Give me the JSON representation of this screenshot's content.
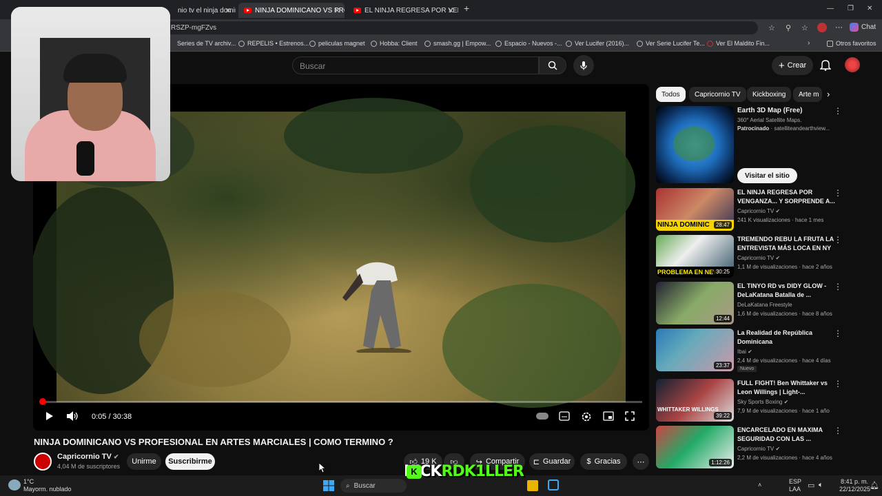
{
  "browser": {
    "tabs": [
      {
        "label": "nio tv el ninja dominicano"
      },
      {
        "label": "NINJA DOMINICANO VS PROFESIO"
      },
      {
        "label": "EL NINJA REGRESA POR VENGANZ"
      }
    ],
    "url": "RSZP-mgFZvs",
    "bookmarks": [
      "Series de TV archiv...",
      "REPELIS • Estrenos...",
      "peliculas magnet",
      "Hobba: Client",
      "smash.gg | Empow...",
      "Espacio - Nuevos -...",
      "Ver Lucifer (2016)...",
      "Ver Serie Lucifer Te...",
      "Ver El Maldito Fin...",
      "Otros favoritos"
    ],
    "chat_label": "Chat"
  },
  "youtube": {
    "search_placeholder": "Buscar",
    "create_label": "Crear"
  },
  "player": {
    "time": "0:05 / 30:38",
    "progress_fraction": 0.003
  },
  "video": {
    "title": "NINJA DOMINICANO VS PROFESIONAL EN ARTES MARCIALES | COMO TERMINO ?",
    "channel": "Capricornio TV",
    "subscribers": "4,04 M de suscriptores",
    "join_label": "Unirme",
    "subscribe_label": "Suscribirme",
    "likes": "19 K",
    "share_label": "Compartir",
    "save_label": "Guardar",
    "thanks_label": "Gracias"
  },
  "chips": [
    "Todos",
    "Capricornio TV",
    "Kickboxing",
    "Arte m"
  ],
  "ad": {
    "title": "Earth 3D Map (Free)",
    "subtitle": "360° Aerial Satellite Maps.",
    "sponsored": "Patrocinado",
    "domain": "satelliteandearthview...",
    "cta": "Visitar el sitio"
  },
  "recommendations": [
    {
      "title": "EL NINJA REGRESA POR VENGANZA... Y SORPRENDE A...",
      "channel": "Capricornio TV",
      "meta": "241 K visualizaciones · hace 1 mes",
      "duration": "28:47",
      "thumb_text": "NINJA DOMINIC"
    },
    {
      "title": "TREMENDO REBU LA FRUTA LA ENTREVISTA MÁS LOCA EN NY",
      "channel": "Capricornio TV",
      "meta": "1,1 M de visualizaciones · hace 2 años",
      "duration": "30:25",
      "thumb_text": "PROBLEMA EN NEW"
    },
    {
      "title": "EL TINYO RD vs DIDY GLOW - DeLaKatana Batalla de ...",
      "channel": "DeLaKatana Freestyle",
      "meta": "1,6 M de visualizaciones · hace 8 años",
      "duration": "12:44",
      "thumb_text": ""
    },
    {
      "title": "La Realidad de República Dominicana",
      "channel": "Ibai",
      "meta": "2,4 M de visualizaciones · hace 4 días",
      "duration": "23:37",
      "thumb_text": "",
      "badge": "Nuevo"
    },
    {
      "title": "FULL FIGHT! Ben Whittaker vs Leon Willings | Light-...",
      "channel": "Sky Sports Boxing",
      "meta": "7,9 M de visualizaciones · hace 1 año",
      "duration": "39:22",
      "thumb_text": "WHITTAKER WILLINGS"
    },
    {
      "title": "ENCARCELADO EN MAXIMA SEGURIDAD CON LAS ...",
      "channel": "Capricornio TV",
      "meta": "2,2 M de visualizaciones · hace 4 años",
      "duration": "1:12:26",
      "thumb_text": ""
    }
  ],
  "taskbar": {
    "temp": "1°C",
    "weather": "Mayorm. nublado",
    "search": "Buscar",
    "lang": "ESP",
    "lang2": "LAA",
    "time": "8:41 p. m.",
    "date": "22/12/2025"
  },
  "overlay": {
    "kick_a": "KICK",
    "kick_b": "RDK1LLER"
  },
  "colors": {
    "accent": "#ff0000",
    "kick": "#53fc18"
  }
}
